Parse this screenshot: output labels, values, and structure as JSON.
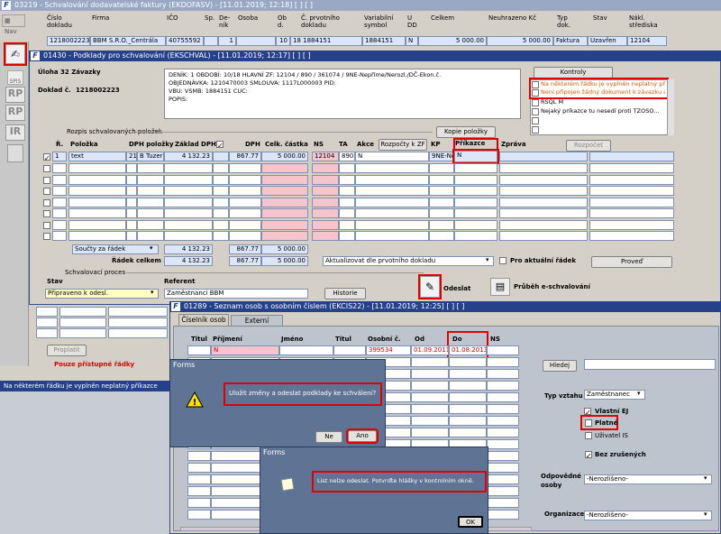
{
  "top": {
    "title": "03219 - Schvalování dodavatelské faktury (EKDOFASV) - [11.01.2019; 12:18] [ ] [ ]",
    "nav": "Nav",
    "cols": [
      "Číslo dokladu",
      "Firma",
      "IČO",
      "Sp.",
      "De-ník",
      "Osoba",
      "Ob d.",
      "Č. prvotního dokladu",
      "Variabilní symbol",
      "U DD",
      "Celkem",
      "Neuhrazeno Kč",
      "Typ dok.",
      "Stav",
      "Nákl. střediska"
    ],
    "row": [
      "1218002223",
      "BBM S.R.O._Centrála",
      "40755592",
      "",
      "1",
      "",
      "10",
      "18 1884151",
      "1884151",
      "N",
      "5 000.00",
      "5 000.00",
      "Faktura",
      "Uzavřen",
      "12104"
    ]
  },
  "side": {
    "icons": [
      "RP",
      "RP",
      "IR"
    ],
    "icon_small": "SPIS"
  },
  "win": {
    "title": "01430 - Podklady pro schvalování (EKSCHVAL) - [11.01.2019; 12:17] [ ] [ ]",
    "uloha": "Úloha 32 Závazky",
    "doklad_label": "Doklad č.",
    "doklad": "1218002223",
    "info": [
      "DENÍK: 1   OBDOBÍ: 10/18   HLAVNÍ ZF: 12104 / 890 /                 361074 / 9NE-Nepříme/Nerozl./DČ-Ekon.č.",
      "OBJEDNÁVKA: 1210470003          SMLOUVA: 1117L000003          PID:",
      "VBU:                         VSMB: 1884151      CUC:",
      "POPIS:"
    ],
    "kontroly": "Kontroly",
    "kontroly_items": [
      "Na některém řádku je vyplněn neplatný příkaz",
      "Není připojen žádný dokument k závazku an",
      "RSQL M",
      "Nejaký príkazce tu nesedí proti TZOSO..."
    ],
    "rozpis": "Rozpis schvalovaných položek",
    "kopie": "Kopie položky",
    "cols": [
      "Ř.",
      "Položka",
      "DPH položky",
      "Základ DPH",
      "DPH",
      "Celk. částka",
      "NS",
      "TA",
      "Akce",
      "Rozpočty k ZF",
      "KP",
      "Příkazce",
      "Zpráva"
    ],
    "rozpocet": "Rozpočet",
    "r1": {
      "n": "1",
      "pol": "text",
      "dph1": "21",
      "dph2": "B Tuzer",
      "zaklad": "4 132.23",
      "dph": "867.77",
      "celk": "5 000.00",
      "ns": "12104",
      "ta": "890",
      "akce": "N",
      "kp": "9NE-Ne",
      "prik": "N"
    },
    "soucty": "Součty za řádek",
    "s_zaklad": "4 132.23",
    "s_dph": "867.77",
    "s_celk": "5 000.00",
    "radek_celkem": "Řádek celkem",
    "c_zaklad": "4 132.23",
    "c_dph": "867.77",
    "c_celk": "5 000.00",
    "aktualizovat": "Aktualizovat dle prvotního dokladu",
    "pro_akt": "Pro aktuální řádek",
    "proved": "Proveď",
    "schvalovaci": "Schvalovací proces",
    "stav_label": "Stav",
    "stav": "Připraveno k odesl.",
    "ref_label": "Referent",
    "ref": "Zaměstnanci BBM",
    "historie": "Historie",
    "odeslat": "Odeslat",
    "prubeh": "Průběh e-schvalování",
    "proplatit": "Proplatit",
    "pouze": "Pouze přístupné řádky"
  },
  "status": "Na některém řádku je vyplněn neplatný příkazce",
  "osoby": {
    "title": "01289 - Seznam osob s osobním číslem (EKCIS22) - [11.01.2019; 12:25] [ ] [ ]",
    "tab1": "Číselník osob",
    "tab2": "Externí číselník",
    "cols": [
      "Titul",
      "Příjmení",
      "Jméno",
      "Titul",
      "Osobní č.",
      "Od",
      "Do",
      "NS"
    ],
    "row": {
      "prijmeni": "N",
      "osc": "399534",
      "od": "01.09.2011",
      "do": "01.08.2013"
    },
    "hledej": "Hledej",
    "typ_label": "Typ vztahu",
    "typ": "Zaměstnanec",
    "vlastni": "Vlastní EJ",
    "platne": "Platné",
    "uzivatel": "Uživatel IS",
    "bez": "Bez zrušených",
    "odpov": "Odpovědné osoby",
    "nerozl": "-Nerozlišeno-",
    "org": "Organizace",
    "nerozl2": "-Nerozlišeno-"
  },
  "dlg1": {
    "title": "Forms",
    "msg": "Uložit změny a odeslat podklady ke schválení?",
    "ne": "Ne",
    "ano": "Ano"
  },
  "dlg2": {
    "title": "Forms",
    "msg": "List nelze odeslat. Potvrďte hlášky v kontrolním okně.",
    "ok": "OK"
  }
}
